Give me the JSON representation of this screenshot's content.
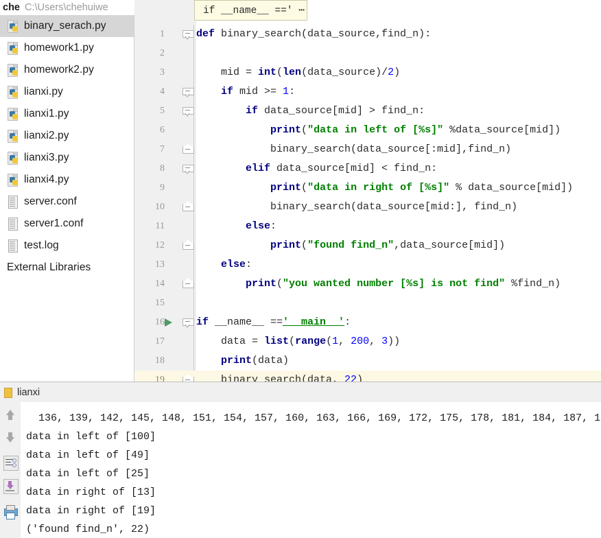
{
  "window": {
    "project_name": "che",
    "project_path": "C:\\Users\\chehuiwe"
  },
  "breadcrumb": {
    "text": "if __name__ ==' ⋯"
  },
  "project_tree": {
    "items": [
      {
        "label": "binary_serach.py",
        "icon": "python-file-icon",
        "selected": true
      },
      {
        "label": "homework1.py",
        "icon": "python-file-icon",
        "selected": false
      },
      {
        "label": "homework2.py",
        "icon": "python-file-icon",
        "selected": false
      },
      {
        "label": "lianxi.py",
        "icon": "python-file-icon",
        "selected": false
      },
      {
        "label": "lianxi1.py",
        "icon": "python-file-icon",
        "selected": false
      },
      {
        "label": "lianxi2.py",
        "icon": "python-file-icon",
        "selected": false
      },
      {
        "label": "lianxi3.py",
        "icon": "python-file-icon",
        "selected": false
      },
      {
        "label": "lianxi4.py",
        "icon": "python-file-icon",
        "selected": false
      },
      {
        "label": "server.conf",
        "icon": "text-file-icon",
        "selected": false
      },
      {
        "label": "server1.conf",
        "icon": "text-file-icon",
        "selected": false
      },
      {
        "label": "test.log",
        "icon": "text-file-icon",
        "selected": false
      },
      {
        "label": "External Libraries",
        "icon": "none",
        "selected": false
      }
    ]
  },
  "editor": {
    "current_line": 19,
    "run_marker_line": 16,
    "lines": [
      {
        "n": "1",
        "text": "def binary_search(data_source,find_n):"
      },
      {
        "n": "2",
        "text": ""
      },
      {
        "n": "3",
        "text": "    mid = int(len(data_source)/2)"
      },
      {
        "n": "4",
        "text": "    if mid >= 1:"
      },
      {
        "n": "5",
        "text": "        if data_source[mid] > find_n:"
      },
      {
        "n": "6",
        "text": "            print(\"data in left of [%s]\" %data_source[mid])"
      },
      {
        "n": "7",
        "text": "            binary_search(data_source[:mid],find_n)"
      },
      {
        "n": "8",
        "text": "        elif data_source[mid] < find_n:"
      },
      {
        "n": "9",
        "text": "            print(\"data in right of [%s]\" % data_source[mid])"
      },
      {
        "n": "10",
        "text": "            binary_search(data_source[mid:], find_n)"
      },
      {
        "n": "11",
        "text": "        else:"
      },
      {
        "n": "12",
        "text": "            print(\"found find_n\",data_source[mid])"
      },
      {
        "n": "13",
        "text": "    else:"
      },
      {
        "n": "14",
        "text": "        print(\"you wanted number [%s] is not find\" %find_n)"
      },
      {
        "n": "15",
        "text": ""
      },
      {
        "n": "16",
        "text": "if __name__ =='__main__':"
      },
      {
        "n": "17",
        "text": "    data = list(range(1, 200, 3))"
      },
      {
        "n": "18",
        "text": "    print(data)"
      },
      {
        "n": "19",
        "text": "    binary_search(data, 22)"
      }
    ]
  },
  "run_panel": {
    "tab_label": "lianxi",
    "toolbar_icons": [
      "arrow-up-icon",
      "arrow-down-icon",
      "soft-wrap-icon",
      "scroll-to-end-icon",
      "print-icon"
    ],
    "output_lines": [
      "  136, 139, 142, 145, 148, 151, 154, 157, 160, 163, 166, 169, 172, 175, 178, 181, 184, 187, 1",
      "data in left of [100]",
      "data in left of [49]",
      "data in left of [25]",
      "data in right of [13]",
      "data in right of [19]",
      "('found find_n', 22)"
    ]
  },
  "colors": {
    "keyword": "#000080",
    "string": "#008000",
    "number": "#0000ff",
    "plain": "#2b2b2b",
    "current_line_bg": "#fcf8e4",
    "gutter_bg": "#f0f0f0",
    "selection_bg": "#d6d6d6",
    "run_arrow": "#4e9a63"
  }
}
